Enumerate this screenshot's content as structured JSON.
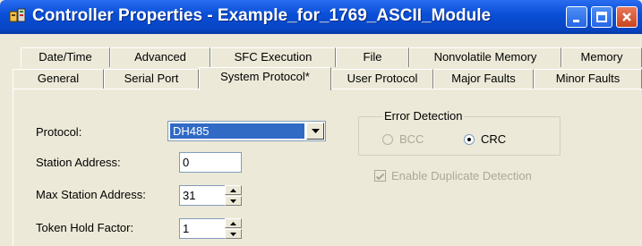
{
  "window": {
    "title": "Controller Properties - Example_for_1769_ASCII_Module",
    "icons": {
      "app": "controller-app-icon",
      "minimize": "minimize-icon",
      "maximize": "maximize-icon",
      "close": "close-icon"
    }
  },
  "tabs": {
    "row1": [
      "Date/Time",
      "Advanced",
      "SFC Execution",
      "File",
      "Nonvolatile Memory",
      "Memory"
    ],
    "row2": [
      "General",
      "Serial Port",
      "System Protocol*",
      "User Protocol",
      "Major Faults",
      "Minor Faults"
    ],
    "selected": "System Protocol*"
  },
  "form": {
    "protocol": {
      "label": "Protocol:",
      "value": "DH485"
    },
    "station_address": {
      "label": "Station Address:",
      "value": "0"
    },
    "max_station_address": {
      "label": "Max Station Address:",
      "value": "31"
    },
    "token_hold_factor": {
      "label": "Token Hold Factor:",
      "value": "1"
    }
  },
  "error_detection": {
    "title": "Error Detection",
    "options": [
      {
        "label": "BCC",
        "selected": false,
        "enabled": false
      },
      {
        "label": "CRC",
        "selected": true,
        "enabled": true
      }
    ]
  },
  "duplicate_detection": {
    "label": "Enable Duplicate Detection",
    "checked": true,
    "enabled": false
  }
}
